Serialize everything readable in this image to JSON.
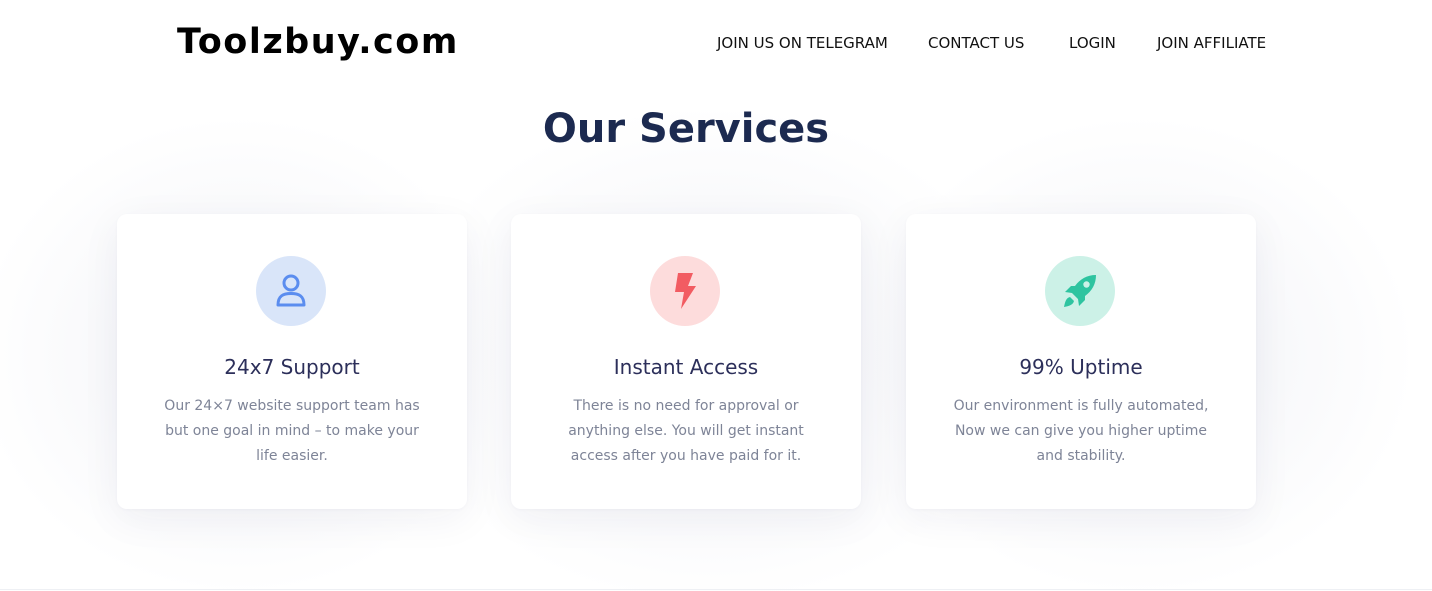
{
  "header": {
    "logo": "Toolzbuy.com",
    "nav": [
      {
        "label": "JOIN US ON TELEGRAM"
      },
      {
        "label": "CONTACT US"
      },
      {
        "label": "LOGIN"
      },
      {
        "label": "JOIN AFFILIATE"
      }
    ]
  },
  "services": {
    "title": "Our Services",
    "cards": [
      {
        "title": "24x7 Support",
        "text": "Our 24×7 website support team has but one goal in mind – to make your life easier.",
        "icon": "user-icon",
        "icon_color": "#5b8def",
        "icon_bg": "#d9e5f9"
      },
      {
        "title": "Instant Access",
        "text": "There is no need for approval or anything else. You will get instant access after you have paid for it.",
        "icon": "lightning-icon",
        "icon_color": "#f25c62",
        "icon_bg": "#fddcdc"
      },
      {
        "title": "99% Uptime",
        "text": "Our environment is fully automated, Now we can give you higher uptime and stability.",
        "icon": "rocket-icon",
        "icon_color": "#2ec4a0",
        "icon_bg": "#ccf1e7"
      }
    ]
  },
  "colors": {
    "title": "#1c2a50",
    "card_title": "#2c2f5a",
    "card_text": "#7e8497"
  }
}
